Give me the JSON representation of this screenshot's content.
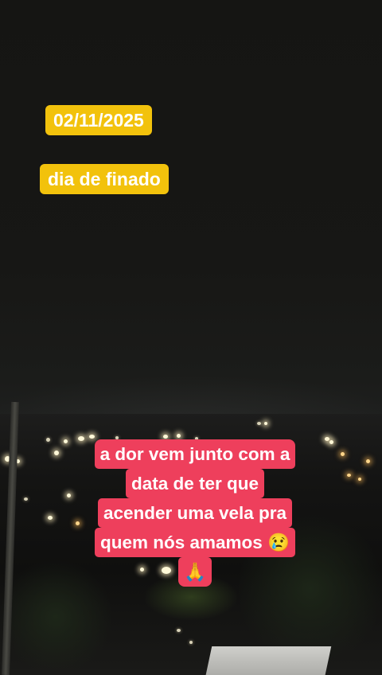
{
  "overlays": {
    "date": "02/11/2025",
    "title": "dia de finado"
  },
  "caption": {
    "lines": [
      "a dor vem junto com a",
      "data de ter que",
      "acender uma vela pra",
      "quem nós amamos 😢",
      "🙏"
    ]
  },
  "colors": {
    "tag_background": "#f2c20c",
    "caption_background": "#ee3f5c",
    "text": "#ffffff"
  }
}
